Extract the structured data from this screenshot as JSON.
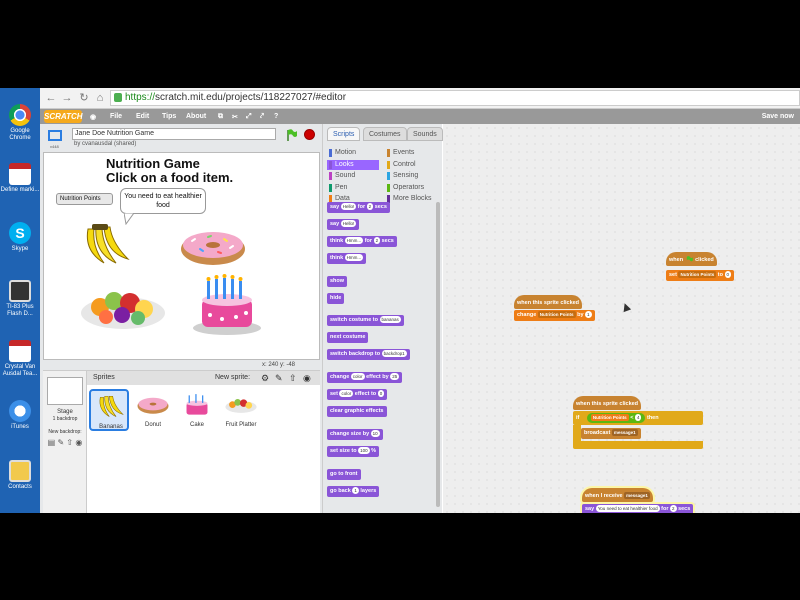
{
  "desktop": {
    "icons": [
      {
        "label": "Google Chrome",
        "icon": "chrome-icon"
      },
      {
        "label": "Define marki...",
        "icon": "pdf-icon"
      },
      {
        "label": "Skype",
        "icon": "skype-icon"
      },
      {
        "label": "TI-83 Plus Flash D...",
        "icon": "calculator-icon"
      },
      {
        "label": "Crystal Van Ausdal Tea...",
        "icon": "pdf-icon"
      },
      {
        "label": "iTunes",
        "icon": "itunes-icon"
      },
      {
        "label": "Contacts",
        "icon": "contacts-icon"
      }
    ]
  },
  "browser": {
    "url_proto": "https://",
    "url_rest": "scratch.mit.edu/projects/118227027/#editor"
  },
  "menubar": {
    "logo": "SCRATCH",
    "items": [
      "File",
      "Edit",
      "Tips",
      "About"
    ],
    "save_now": "Save now"
  },
  "project": {
    "title": "Jane Doe Nutrition Game",
    "byline": "by cvanausdal (shared)",
    "version": "v448"
  },
  "stage": {
    "title_line1": "Nutrition Game",
    "title_line2": "Click on a food item.",
    "monitor_label": "Nutrition Points",
    "monitor_value": "",
    "bubble": "You need to eat healthier food",
    "coords": "x: 240  y: -48"
  },
  "sprites_pane": {
    "header": "Sprites",
    "new_sprite": "New sprite:",
    "stage_label": "Stage",
    "stage_sub": "1 backdrop",
    "new_backdrop": "New backdrop:",
    "sprites": [
      "Bananas",
      "Donut",
      "Cake",
      "Fruit Platter"
    ]
  },
  "palette": {
    "tabs": [
      "Scripts",
      "Costumes",
      "Sounds"
    ],
    "categories": [
      {
        "name": "Motion",
        "color": "#4a6cd4"
      },
      {
        "name": "Events",
        "color": "#c88330"
      },
      {
        "name": "Looks",
        "color": "#8a55d7"
      },
      {
        "name": "Control",
        "color": "#e1a91a"
      },
      {
        "name": "Sound",
        "color": "#bb42c3"
      },
      {
        "name": "Sensing",
        "color": "#2ca5e2"
      },
      {
        "name": "Pen",
        "color": "#0e9a6c"
      },
      {
        "name": "Operators",
        "color": "#5cb712"
      },
      {
        "name": "Data",
        "color": "#ee7d16"
      },
      {
        "name": "More Blocks",
        "color": "#632d99"
      }
    ],
    "blocks": [
      {
        "text": "say",
        "arg": "Hello!",
        "text2": "for",
        "arg2": "2",
        "text3": "secs"
      },
      {
        "text": "say",
        "arg": "Hello!"
      },
      {
        "text": "think",
        "arg": "Hmm...",
        "text2": "for",
        "arg2": "2",
        "text3": "secs"
      },
      {
        "text": "think",
        "arg": "Hmm..."
      },
      {
        "text": "show"
      },
      {
        "text": "hide"
      },
      {
        "text": "switch costume to",
        "arg": "bananas"
      },
      {
        "text": "next costume"
      },
      {
        "text": "switch backdrop to",
        "arg": "backdrop1"
      },
      {
        "text": "change",
        "arg": "color",
        "text2": "effect by",
        "arg2": "25"
      },
      {
        "text": "set",
        "arg": "color",
        "text2": "effect to",
        "arg2": "0"
      },
      {
        "text": "clear graphic effects"
      },
      {
        "text": "change size by",
        "arg": "10"
      },
      {
        "text": "set size to",
        "arg": "100",
        "text2": "%"
      },
      {
        "text": "go to front"
      },
      {
        "text": "go back",
        "arg": "1",
        "text2": "layers"
      }
    ]
  },
  "scripts": {
    "flag_hat": {
      "when": "when",
      "clicked": "clicked"
    },
    "set_block": {
      "text": "set",
      "var": "Nutrition Points",
      "to": "to",
      "val": "0"
    },
    "sprite_hat_1": "when this sprite clicked",
    "change_block": {
      "text": "change",
      "var": "Nutrition Points",
      "by": "by",
      "val": "1"
    },
    "sprite_hat_2": "when this sprite clicked",
    "if_block": {
      "if": "if",
      "then": "then",
      "var": "Nutrition Points",
      "op": "<",
      "val": "4"
    },
    "broadcast_block": {
      "text": "broadcast",
      "msg": "message1"
    },
    "receive_hat": {
      "text": "when I receive",
      "msg": "message1"
    },
    "say_block": {
      "say": "say",
      "msg": "You need to eat healthier food",
      "for": "for",
      "secs_val": "2",
      "secs": "secs"
    }
  }
}
